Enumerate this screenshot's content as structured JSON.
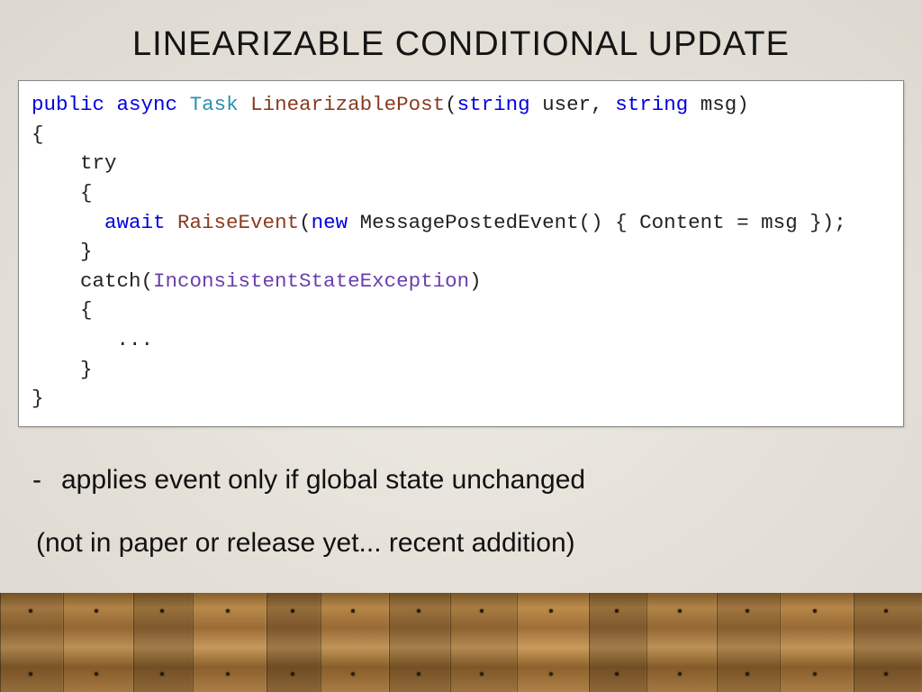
{
  "title": "LINEARIZABLE CONDITIONAL UPDATE",
  "code": {
    "l1_kw1": "public",
    "l1_kw2": "async",
    "l1_type": "Task",
    "l1_meth": "LinearizablePost",
    "l1_p1t": "string",
    "l1_p1n": " user, ",
    "l1_p2t": "string",
    "l1_p2n": " msg)",
    "l2": "{",
    "l3": "    try",
    "l4": "    {",
    "l5_ind": "      ",
    "l5_kw1": "await",
    "l5_meth": "RaiseEvent",
    "l5_kw2": "new",
    "l5_rest": " MessagePostedEvent() { Content = msg });",
    "l6": "    }",
    "l7a": "    catch(",
    "l7ex": "InconsistentStateException",
    "l7b": ")",
    "l8": "    {",
    "l9": "       ...",
    "l10": "    }",
    "l11": "}"
  },
  "bullet": "applies event only if global state unchanged",
  "note": "(not in paper or release yet... recent addition)"
}
